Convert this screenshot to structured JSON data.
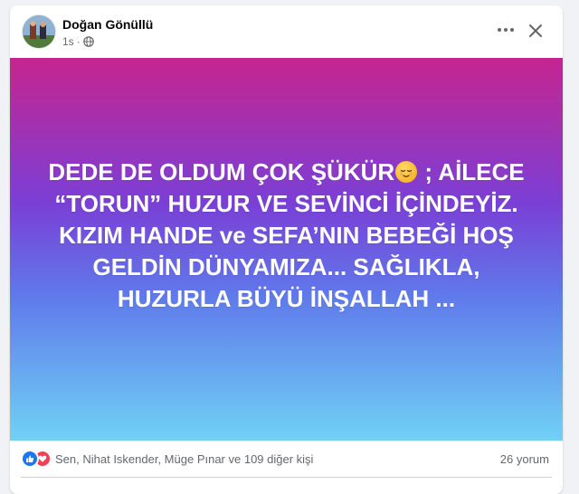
{
  "post": {
    "author": "Doğan Gönüllü",
    "time": "1s",
    "separator": "·",
    "text_part1": "DEDE DE OLDUM ÇOK ŞÜKÜR",
    "text_part2": " ; AİLECE “TORUN” HUZUR VE SEVİNCİ İÇİNDEYİZ. KIZIM HANDE ve SEFA’NIN BEBEĞİ HOŞ GELDİN DÜNYAMIZA... SAĞLIKLA, HUZURLA BÜYÜ İNŞALLAH ...",
    "reactions_text": "Sen, Nihat Iskender, Müge Pınar ve 109 diğer kişi",
    "comments": "26 yorum"
  },
  "icons": {
    "privacy": "globe-icon",
    "more": "more-horizontal-icon",
    "close": "close-icon",
    "emoji": "relieved-face-emoji",
    "like": "like-icon",
    "love": "love-icon"
  },
  "colors": {
    "gradient_top": "#c6258f",
    "gradient_mid": "#7a3fd6",
    "gradient_bottom": "#6fd2f5",
    "like_blue": "#1877f2",
    "love_red": "#f33e58"
  }
}
